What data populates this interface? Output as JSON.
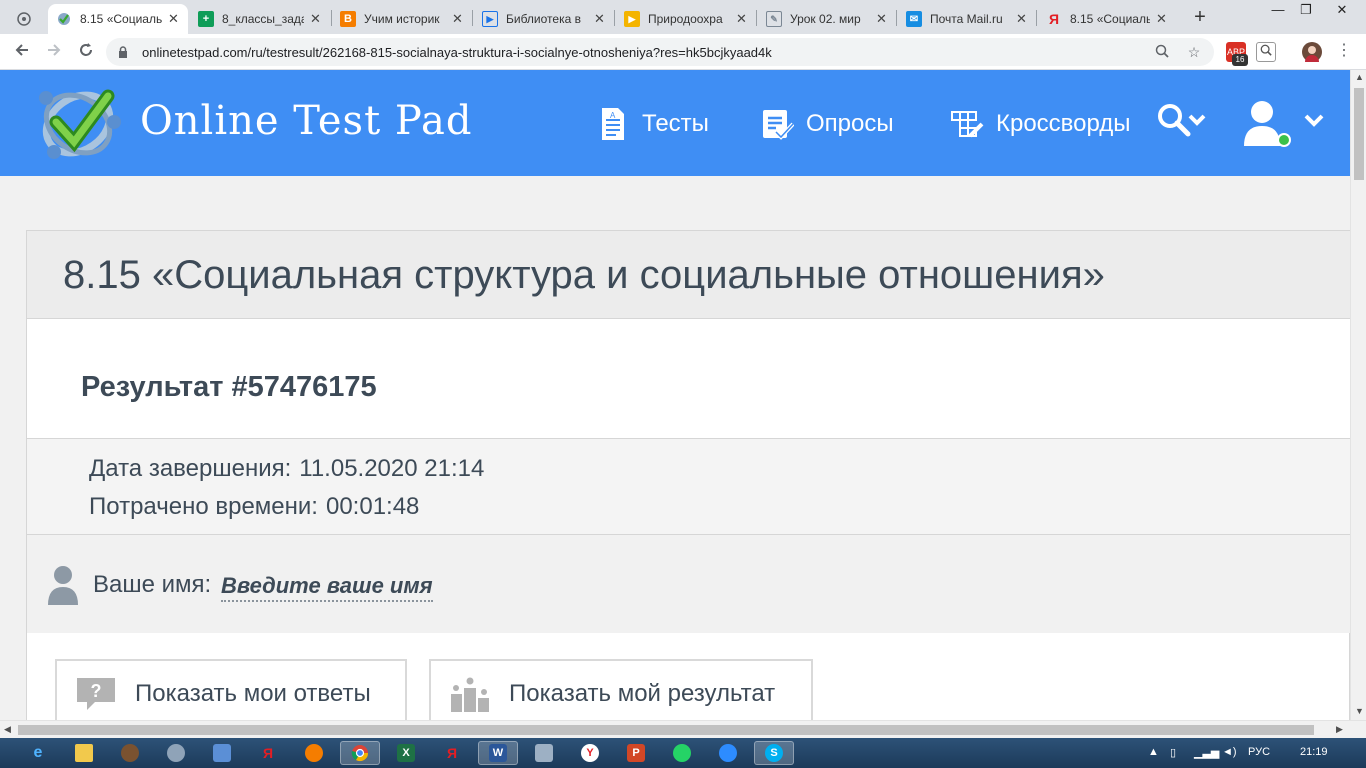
{
  "browser": {
    "tabs": [
      {
        "label": "",
        "favicon": "chrome-apps-icon",
        "color": "#5f6368"
      },
      {
        "label": "8.15 «Социальн",
        "favicon": "online-test-pad-icon",
        "color": "#3f8ef4",
        "active": true
      },
      {
        "label": "8_классы_зада",
        "favicon": "google-sheets-icon",
        "color": "#0f9d58"
      },
      {
        "label": "Учим историк",
        "favicon": "blogger-icon",
        "color": "#f57d00"
      },
      {
        "label": "Библиотека в",
        "favicon": "video-icon",
        "color": "#1a73e8"
      },
      {
        "label": "Природоохра",
        "favicon": "slides-icon",
        "color": "#f4b400"
      },
      {
        "label": "Урок 02. мир",
        "favicon": "document-icon",
        "color": "#7b8794"
      },
      {
        "label": "Почта Mail.ru",
        "favicon": "mail-ru-icon",
        "color": "#168de2"
      },
      {
        "label": "8.15 «Социаль",
        "favicon": "yandex-icon",
        "color": "#e31e24"
      }
    ],
    "new_tab": "+",
    "window_controls": {
      "minimize": "—",
      "maximize": "❐",
      "close": "✕"
    },
    "url": "onlinetestpad.com/ru/testresult/262168-815-socialnaya-struktura-i-socialnye-otnosheniya?res=hk5bcjkyaad4k",
    "extension_badge": "16"
  },
  "site": {
    "brand": "Online Test Pad",
    "nav": [
      {
        "label": "Тесты",
        "icon": "tests-icon"
      },
      {
        "label": "Опросы",
        "icon": "surveys-icon"
      },
      {
        "label": "Кроссворды",
        "icon": "crosswords-icon"
      }
    ],
    "accent": "#3f8ef4"
  },
  "result": {
    "test_title": "8.15 «Социальная структура и социальные отношения»",
    "result_title": "Результат #57476175",
    "completion_label": "Дата завершения:",
    "completion_value": "11.05.2020 21:14",
    "time_label": "Потрачено времени:",
    "time_value": "00:01:48",
    "name_label": "Ваше имя:",
    "name_link": "Введите ваше имя",
    "show_answers": "Показать мои ответы",
    "show_result": "Показать мой результат"
  },
  "taskbar": {
    "apps": [
      "ie-icon",
      "explorer-icon",
      "media-icon",
      "network-icon",
      "audio-icon",
      "yandex-icon",
      "firefox-icon",
      "chrome-icon",
      "excel-icon",
      "yandex-icon",
      "word-icon",
      "calculator-icon",
      "yandex-browser-icon",
      "powerpoint-icon",
      "whatsapp-icon",
      "zoom-icon",
      "skype-icon"
    ],
    "language": "РУС",
    "clock": "21:19"
  }
}
